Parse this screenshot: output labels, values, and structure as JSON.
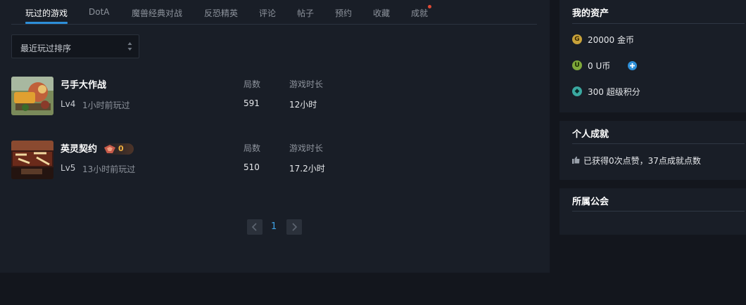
{
  "tabs": [
    {
      "label": "玩过的游戏",
      "active": true
    },
    {
      "label": "DotA"
    },
    {
      "label": "魔兽经典对战"
    },
    {
      "label": "反恐精英"
    },
    {
      "label": "评论"
    },
    {
      "label": "帖子"
    },
    {
      "label": "预约"
    },
    {
      "label": "收藏"
    },
    {
      "label": "成就"
    }
  ],
  "sort": {
    "selected": "最近玩过排序"
  },
  "games": [
    {
      "name": "弓手大作战",
      "level": "Lv4",
      "last_played": "1小时前玩过",
      "rounds_label": "局数",
      "rounds": "591",
      "time_label": "游戏时长",
      "time": "12小时"
    },
    {
      "name": "英灵契约",
      "badge_count": "0",
      "level": "Lv5",
      "last_played": "13小时前玩过",
      "rounds_label": "局数",
      "rounds": "510",
      "time_label": "游戏时长",
      "time": "17.2小时"
    }
  ],
  "pagination": {
    "current": "1"
  },
  "assets": {
    "title": "我的资产",
    "gold": "20000 金币",
    "ucoin": "0 U币",
    "points": "300 超级积分"
  },
  "achievements": {
    "title": "个人成就",
    "text": "已获得0次点赞，37点成就点数"
  },
  "guild": {
    "title": "所属公会"
  },
  "colors": {
    "accent": "#2d8fd8",
    "page_num": "#3ea2e6",
    "badge": "#f0b040",
    "dot": "#e04a35"
  }
}
